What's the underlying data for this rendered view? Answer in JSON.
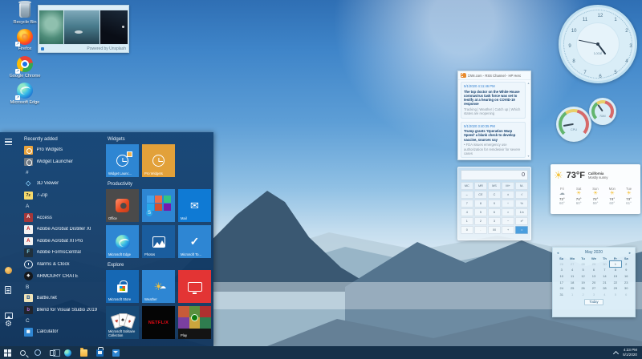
{
  "colors": {
    "accent": "#0078d7",
    "tile_blue": "#2e86d3",
    "menu_bg": "#15446c",
    "taskbar_bg": "#16314a",
    "netflix_red": "#e50914",
    "pro_widgets_orange": "#e2a13a",
    "gauge_green": "#63b56e",
    "gauge_yellow": "#e8d06a",
    "gauge_red": "#d66a6a"
  },
  "desktop": {
    "icons": [
      {
        "key": "recycle",
        "label": "Recycle Bin",
        "shortcut": false
      },
      {
        "key": "firefox",
        "label": "Firefox",
        "shortcut": true
      },
      {
        "key": "chrome",
        "label": "Google Chrome",
        "shortcut": true
      },
      {
        "key": "edge",
        "label": "Microsoft Edge",
        "shortcut": true
      }
    ]
  },
  "slideshow": {
    "powered_by": "Powered by Unsplash"
  },
  "start_menu": {
    "list_header": "Recently added",
    "apps": [
      {
        "t": "app",
        "key": "pro-widgets",
        "label": "Pro Widgets"
      },
      {
        "t": "app",
        "key": "widget-launcher",
        "label": "Widget Launcher"
      },
      {
        "t": "sec",
        "label": "#"
      },
      {
        "t": "app",
        "key": "3d-viewer",
        "label": "3D Viewer",
        "glyph": "◇"
      },
      {
        "t": "app",
        "key": "7zip",
        "label": "7-Zip",
        "glyph": "7z"
      },
      {
        "t": "sec",
        "label": "A"
      },
      {
        "t": "app",
        "key": "access",
        "label": "Access",
        "glyph": "A"
      },
      {
        "t": "app",
        "key": "distiller",
        "label": "Adobe Acrobat Distiller XI",
        "glyph": "A"
      },
      {
        "t": "app",
        "key": "acrobat",
        "label": "Adobe Acrobat XI Pro",
        "glyph": "A"
      },
      {
        "t": "app",
        "key": "formscentral",
        "label": "Adobe FormsCentral",
        "glyph": "F"
      },
      {
        "t": "app",
        "key": "alarms",
        "label": "Alarms & Clock",
        "glyph": ""
      },
      {
        "t": "app",
        "key": "armoury",
        "label": "ARMOURY CRATE",
        "glyph": "◆"
      },
      {
        "t": "sec",
        "label": "B"
      },
      {
        "t": "app",
        "key": "battlenet",
        "label": "Battle.net",
        "glyph": "B"
      },
      {
        "t": "app",
        "key": "blend",
        "label": "Blend for Visual Studio 2019",
        "glyph": "b"
      },
      {
        "t": "sec",
        "label": "C"
      },
      {
        "t": "app",
        "key": "calculator",
        "label": "Calculator",
        "glyph": "▦"
      }
    ],
    "groups": [
      {
        "title": "Widgets",
        "tiles": [
          {
            "key": "widget-launcher",
            "label": "Widget Launc..."
          },
          {
            "key": "pro-widgets",
            "label": "Pro Widgets"
          }
        ]
      },
      {
        "title": "Productivity",
        "tiles": [
          {
            "key": "office",
            "label": "Office"
          },
          {
            "key": "office-folder",
            "label": ""
          },
          {
            "key": "mail",
            "label": "Mail"
          },
          {
            "key": "edge",
            "label": "Microsoft Edge"
          },
          {
            "key": "photos",
            "label": "Photos"
          },
          {
            "key": "todo",
            "label": "Microsoft To..."
          }
        ]
      },
      {
        "title": "Explore",
        "tiles": [
          {
            "key": "store",
            "label": "Microsoft Store"
          },
          {
            "key": "weather",
            "label": "Weather"
          },
          {
            "key": "tv",
            "label": ""
          },
          {
            "key": "solitaire",
            "label": "Microsoft Solitaire Collection"
          },
          {
            "key": "netflix",
            "label": "",
            "text": "NETFLIX"
          },
          {
            "key": "play",
            "label": "Play"
          }
        ]
      }
    ]
  },
  "widgets": {
    "clock": {
      "label": "Local",
      "numbers": [
        1,
        2,
        3,
        4,
        5,
        6,
        7,
        8,
        9,
        10,
        11,
        12
      ],
      "hour_angle": 143,
      "minute_angle": 282
    },
    "gauges": {
      "large": "CPU",
      "small": "RAM",
      "large_needle": -100,
      "small_needle": -35
    },
    "rss": {
      "title": "CNN.com - RSS Channel - HP Hero",
      "items": [
        {
          "time": "5/1/2020 4:11:46 PM",
          "headline": "The top doctor on the White House coronavirus task force was set to testify at a hearing on COVID-19 response",
          "summary": "Tracking | Weather | Catch up | Which states are reopening"
        },
        {
          "time": "5/1/2020 3:40:35 PM",
          "headline": "Trump grants 'Operation Warp Speed' a blank check to develop vaccine, sources say",
          "summary": "• FDA issues emergency use authorization for remdesivir for severe cases"
        }
      ]
    },
    "calculator": {
      "display": "0",
      "buttons": [
        [
          "MC",
          "MR",
          "MS",
          "M+",
          "M-"
        ],
        [
          "←",
          "CE",
          "C",
          "±",
          "√"
        ],
        [
          "7",
          "8",
          "9",
          "÷",
          "%"
        ],
        [
          "4",
          "5",
          "6",
          "×",
          "1/x"
        ],
        [
          "1",
          "2",
          "3",
          "−",
          "x²"
        ],
        [
          "0",
          ".",
          "00",
          "+",
          "="
        ]
      ]
    },
    "weather": {
      "temp": "73°F",
      "location": "California",
      "condition": "Mostly sunny",
      "forecast": [
        {
          "day": "Fri",
          "icon": "cloud",
          "hi": "72°",
          "lo": "60°"
        },
        {
          "day": "Sat",
          "icon": "sun",
          "hi": "74°",
          "lo": "60°"
        },
        {
          "day": "Sun",
          "icon": "sun",
          "hi": "72°",
          "lo": "59°"
        },
        {
          "day": "Mon",
          "icon": "sun",
          "hi": "74°",
          "lo": "60°"
        },
        {
          "day": "Tue",
          "icon": "sun",
          "hi": "73°",
          "lo": "61°"
        }
      ]
    },
    "calendar": {
      "title": "May 2020",
      "prev": "◄",
      "next": "►",
      "day_headers": [
        "Su",
        "Mo",
        "Tu",
        "We",
        "Th",
        "Fr",
        "Sa"
      ],
      "cells": [
        {
          "d": "26",
          "m": 1
        },
        {
          "d": "27",
          "m": 1
        },
        {
          "d": "28",
          "m": 1
        },
        {
          "d": "29",
          "m": 1
        },
        {
          "d": "30",
          "m": 1
        },
        {
          "d": "1",
          "sel": 1
        },
        {
          "d": "2"
        },
        {
          "d": "3"
        },
        {
          "d": "4"
        },
        {
          "d": "5"
        },
        {
          "d": "6"
        },
        {
          "d": "7"
        },
        {
          "d": "8"
        },
        {
          "d": "9"
        },
        {
          "d": "10"
        },
        {
          "d": "11"
        },
        {
          "d": "12"
        },
        {
          "d": "13"
        },
        {
          "d": "14"
        },
        {
          "d": "15"
        },
        {
          "d": "16"
        },
        {
          "d": "17"
        },
        {
          "d": "18"
        },
        {
          "d": "19"
        },
        {
          "d": "20"
        },
        {
          "d": "21"
        },
        {
          "d": "22"
        },
        {
          "d": "23"
        },
        {
          "d": "24"
        },
        {
          "d": "25"
        },
        {
          "d": "26"
        },
        {
          "d": "27"
        },
        {
          "d": "28"
        },
        {
          "d": "29"
        },
        {
          "d": "30"
        },
        {
          "d": "31"
        },
        {
          "d": "1",
          "m": 1
        },
        {
          "d": "2",
          "m": 1
        },
        {
          "d": "3",
          "m": 1
        },
        {
          "d": "4",
          "m": 1
        },
        {
          "d": "5",
          "m": 1
        },
        {
          "d": "6",
          "m": 1
        }
      ],
      "today": "Today"
    }
  },
  "taskbar": {
    "time": "4:23 PM",
    "date": "5/1/2020"
  }
}
